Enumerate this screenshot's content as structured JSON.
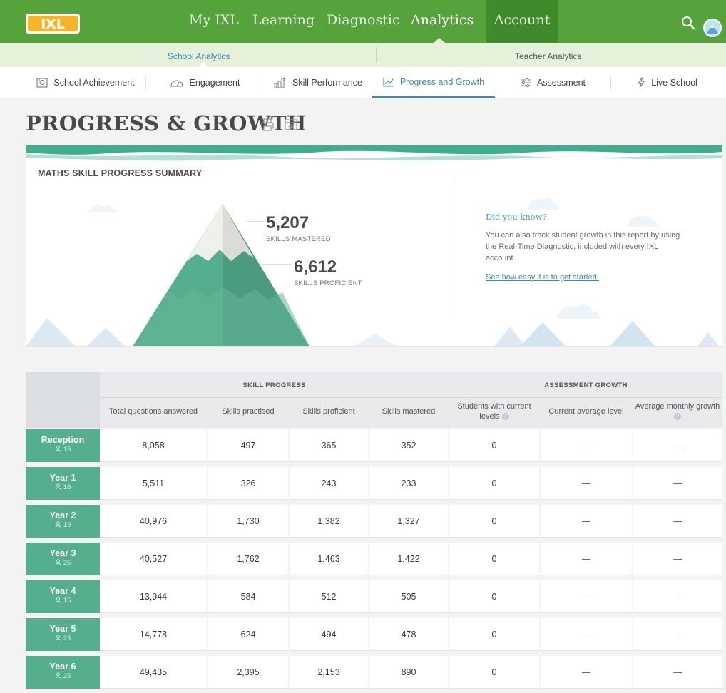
{
  "nav": {
    "logo": "IXL",
    "items": [
      "My IXL",
      "Learning",
      "Diagnostic",
      "Analytics",
      "Account"
    ],
    "active": "Analytics"
  },
  "subnav": {
    "items": [
      "School Analytics",
      "Teacher Analytics"
    ],
    "active": "School Analytics"
  },
  "tabs": {
    "items": [
      "School Achievement",
      "Engagement",
      "Skill Performance",
      "Progress and Growth",
      "Assessment",
      "Live School"
    ],
    "active": "Progress and Growth"
  },
  "page": {
    "title": "PROGRESS & GROWTH"
  },
  "summary": {
    "title": "MATHS SKILL PROGRESS SUMMARY",
    "mastered_value": "5,207",
    "mastered_label": "SKILLS MASTERED",
    "proficient_value": "6,612",
    "proficient_label": "SKILLS PROFICIENT",
    "tip_title": "Did you know?",
    "tip_body": "You can also track student growth in this report by using the Real-Time Diagnostic, included with every IXL account.",
    "tip_link": "See how easy it is to get started!"
  },
  "table": {
    "groups": [
      "SKILL PROGRESS",
      "ASSESSMENT GROWTH"
    ],
    "columns": [
      "Total questions answered",
      "Skills practised",
      "Skills proficient",
      "Skills mastered",
      "Students with current levels",
      "Current average level",
      "Average monthly growth"
    ],
    "rows": [
      {
        "name": "Reception",
        "students": "15",
        "values": [
          "8,058",
          "497",
          "365",
          "352",
          "0",
          "—",
          "—"
        ]
      },
      {
        "name": "Year 1",
        "students": "16",
        "values": [
          "5,511",
          "326",
          "243",
          "233",
          "0",
          "—",
          "—"
        ]
      },
      {
        "name": "Year 2",
        "students": "19",
        "values": [
          "40,976",
          "1,730",
          "1,382",
          "1,327",
          "0",
          "—",
          "—"
        ]
      },
      {
        "name": "Year 3",
        "students": "25",
        "values": [
          "40,527",
          "1,762",
          "1,463",
          "1,422",
          "0",
          "—",
          "—"
        ]
      },
      {
        "name": "Year 4",
        "students": "15",
        "values": [
          "13,944",
          "584",
          "512",
          "505",
          "0",
          "—",
          "—"
        ]
      },
      {
        "name": "Year 5",
        "students": "23",
        "values": [
          "14,778",
          "624",
          "494",
          "478",
          "0",
          "—",
          "—"
        ]
      },
      {
        "name": "Year 6",
        "students": "25",
        "values": [
          "49,435",
          "2,395",
          "2,153",
          "890",
          "0",
          "—",
          "—"
        ]
      }
    ]
  },
  "colors": {
    "nav_green": "#56a23b",
    "row_label": "#55ae8d",
    "accent_blue": "#3a8ab5"
  },
  "icons": [
    "search-icon",
    "avatar",
    "print-icon",
    "export-icon",
    "user-icon",
    "help-icon"
  ]
}
